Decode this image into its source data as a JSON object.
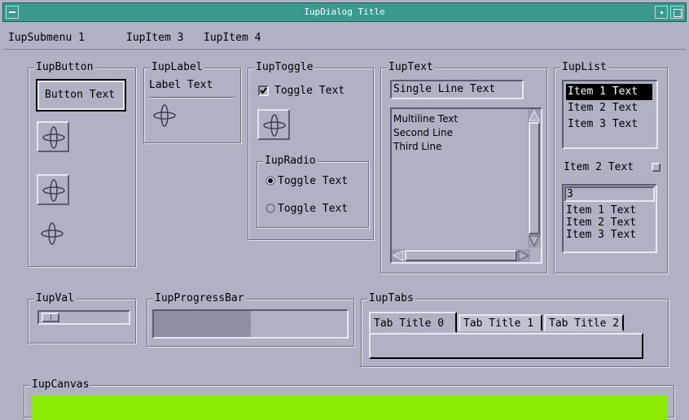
{
  "window": {
    "title": "IupDialog Title"
  },
  "menu": {
    "items": [
      "IupSubmenu 1",
      "IupItem 3",
      "IupItem 4"
    ]
  },
  "button_frame": {
    "title": "IupButton",
    "button_label": "Button Text"
  },
  "label_frame": {
    "title": "IupLabel",
    "label_text": "Label Text"
  },
  "toggle_frame": {
    "title": "IupToggle",
    "toggle_label": "Toggle Text",
    "toggle_checked": true,
    "radio": {
      "title": "IupRadio",
      "options": [
        "Toggle Text",
        "Toggle Text"
      ],
      "selected_index": 0
    }
  },
  "text_frame": {
    "title": "IupText",
    "single_line_value": "Single Line Text",
    "multiline_lines": [
      "Multiline Text",
      "Second Line",
      "Third Line"
    ]
  },
  "list_frame": {
    "title": "IupList",
    "list_items": [
      "Item 1 Text",
      "Item 2 Text",
      "Item 3 Text"
    ],
    "list_selected_index": 0,
    "dropdown_value": "Item 2 Text",
    "edit_value": "3",
    "edit_items": [
      "Item 1 Text",
      "Item 2 Text",
      "Item 3 Text"
    ]
  },
  "val_frame": {
    "title": "IupVal",
    "value_fraction": 0.02
  },
  "progress_frame": {
    "title": "IupProgressBar",
    "progress_fraction": 0.5
  },
  "tabs_frame": {
    "title": "IupTabs",
    "tabs": [
      "Tab Title 0",
      "Tab Title 1",
      "Tab Title 2"
    ],
    "active_index": 0
  },
  "canvas_frame": {
    "title": "IupCanvas",
    "canvas_color": "#8aea00"
  },
  "colors": {
    "title_bar": "#3b9a8e",
    "background": "#aeb2c3",
    "canvas": "#8aea00"
  }
}
